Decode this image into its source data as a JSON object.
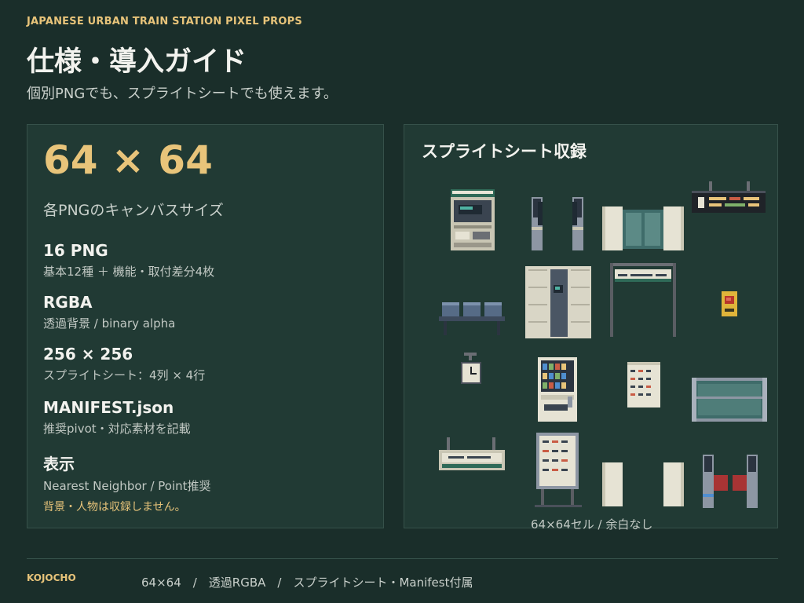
{
  "header": {
    "eyebrow": "JAPANESE URBAN TRAIN STATION PIXEL PROPS",
    "title": "仕様・導入ガイド",
    "subtitle": "個別PNGでも、スプライトシートでも使えます。"
  },
  "specs": {
    "canvas_size": "64 × 64",
    "canvas_note": "各PNGのキャンバスサイズ",
    "items": [
      {
        "title": "16 PNG",
        "desc": "基本12種 ＋ 機能・取付差分4枚"
      },
      {
        "title": "RGBA",
        "desc": "透過背景 / binary alpha"
      },
      {
        "title": "256 × 256",
        "desc": "スプライトシート：4列 × 4行"
      },
      {
        "title": "MANIFEST.json",
        "desc": "推奨pivot・対応素材を記載"
      },
      {
        "title": "表示",
        "desc": "Nearest Neighbor / Point推奨"
      }
    ],
    "note": "背景・人物は収録しません。"
  },
  "sprite_sheet": {
    "title": "スプライトシート収録",
    "cell_note": "64×64セル / 余白なし",
    "sprites": [
      "ticket-machine-sprite",
      "ticket-gate-sprite",
      "glass-partition-sprite",
      "departure-board-sprite",
      "bench-sprite",
      "coin-locker-sprite",
      "hanging-sign-frame-sprite",
      "emergency-button-sprite",
      "station-clock-sprite",
      "vending-machine-sprite",
      "timetable-sprite",
      "glass-fence-sprite",
      "ceiling-sign-sprite",
      "standing-timetable-sprite",
      "pillar-sprite",
      "ic-gate-sprite"
    ]
  },
  "footer": {
    "brand": "KOJOCHO",
    "text": "64×64　/　透過RGBA　/　スプライトシート・Manifest付属"
  },
  "colors": {
    "background": "#1a2e2a",
    "panel": "#213a34",
    "accent": "#e8c47a"
  }
}
